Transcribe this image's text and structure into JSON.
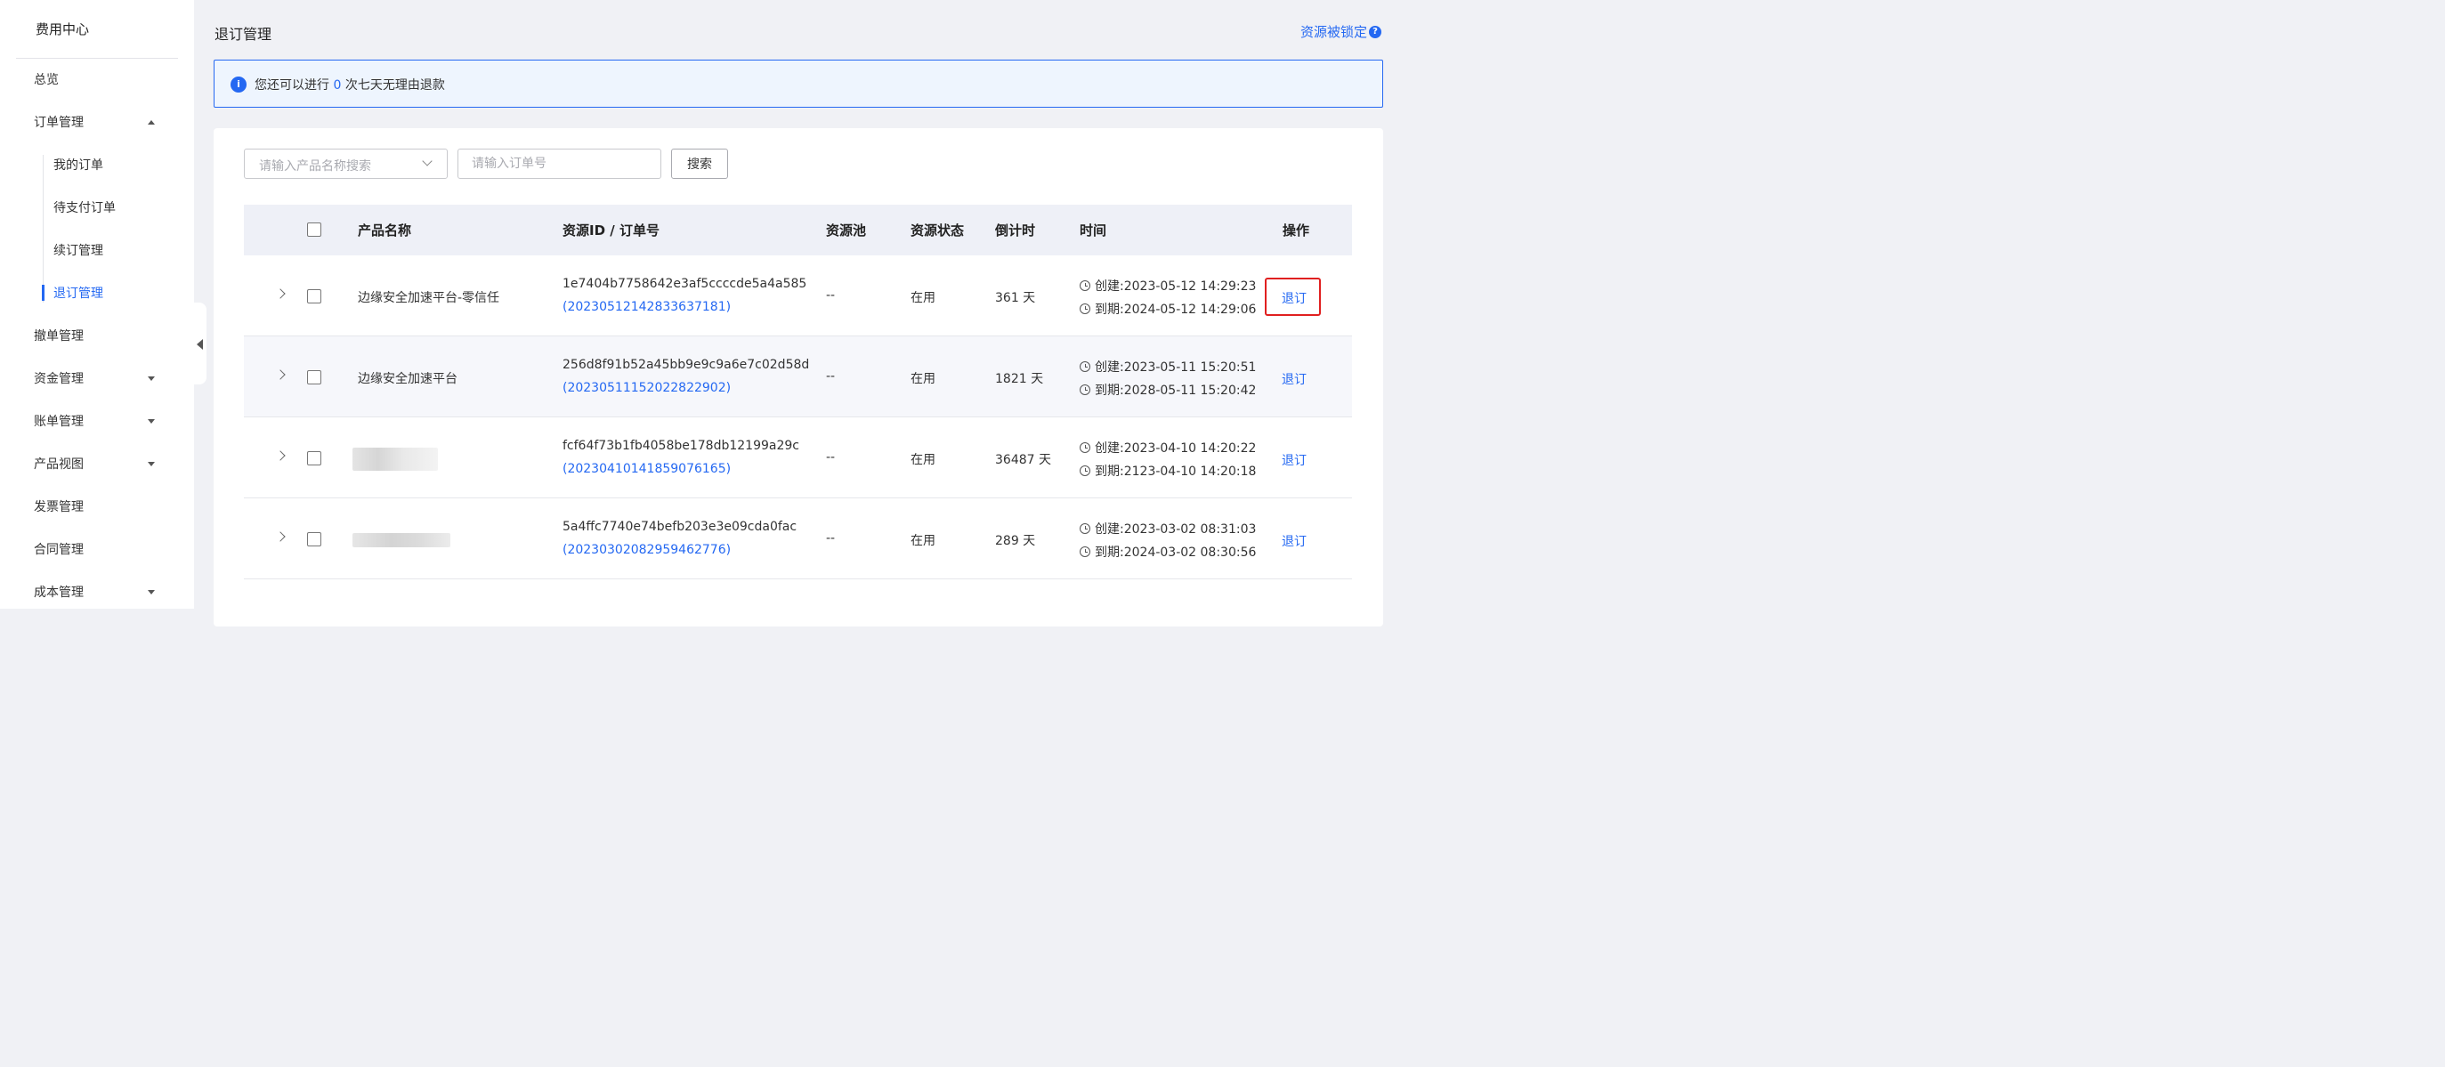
{
  "sidebar": {
    "title": "费用中心",
    "items": [
      {
        "label": "总览"
      },
      {
        "label": "订单管理"
      },
      {
        "label": "撤单管理"
      },
      {
        "label": "资金管理"
      },
      {
        "label": "账单管理"
      },
      {
        "label": "产品视图"
      },
      {
        "label": "发票管理"
      },
      {
        "label": "合同管理"
      },
      {
        "label": "成本管理"
      }
    ],
    "sub_items": [
      {
        "label": "我的订单"
      },
      {
        "label": "待支付订单"
      },
      {
        "label": "续订管理"
      },
      {
        "label": "退订管理",
        "active": true
      }
    ]
  },
  "header": {
    "title": "退订管理",
    "locked_link": "资源被锁定",
    "help_icon_glyph": "?"
  },
  "banner": {
    "icon_glyph": "i",
    "text_before": "您还可以进行",
    "count": "0",
    "text_after": "次七天无理由退款"
  },
  "filters": {
    "product_placeholder": "请输入产品名称搜索",
    "order_placeholder": "请输入订单号",
    "search_label": "搜索"
  },
  "table": {
    "columns": [
      "产品名称",
      "资源ID / 订单号",
      "资源池",
      "资源状态",
      "倒计时",
      "时间",
      "操作"
    ],
    "rows": [
      {
        "product": "边缘安全加速平台-零信任",
        "resource_id": "1e7404b7758642e3af5ccccde5a4a585",
        "order_no": "(20230512142833637181)",
        "pool": "--",
        "status": "在用",
        "countdown": "361 天",
        "created": "创建:2023-05-12 14:29:23",
        "expires": "到期:2024-05-12 14:29:06",
        "action": "退订",
        "highlighted": true
      },
      {
        "product": "边缘安全加速平台",
        "resource_id": "256d8f91b52a45bb9e9c9a6e7c02d58d",
        "order_no": "(20230511152022822902)",
        "pool": "--",
        "status": "在用",
        "countdown": "1821 天",
        "created": "创建:2023-05-11 15:20:51",
        "expires": "到期:2028-05-11 15:20:42",
        "action": "退订"
      },
      {
        "product": "",
        "resource_id": "fcf64f73b1fb4058be178db12199a29c",
        "order_no": "(20230410141859076165)",
        "pool": "--",
        "status": "在用",
        "countdown": "36487 天",
        "created": "创建:2023-04-10 14:20:22",
        "expires": "到期:2123-04-10 14:20:18",
        "action": "退订"
      },
      {
        "product": "",
        "resource_id": "5a4ffc7740e74befb203e3e09cda0fac",
        "order_no": "(20230302082959462776)",
        "pool": "--",
        "status": "在用",
        "countdown": "289 天",
        "created": "创建:2023-03-02 08:31:03",
        "expires": "到期:2024-03-02 08:30:56",
        "action": "退订"
      }
    ]
  },
  "colors": {
    "accent": "#2468f2",
    "highlight_border": "#e02020"
  }
}
